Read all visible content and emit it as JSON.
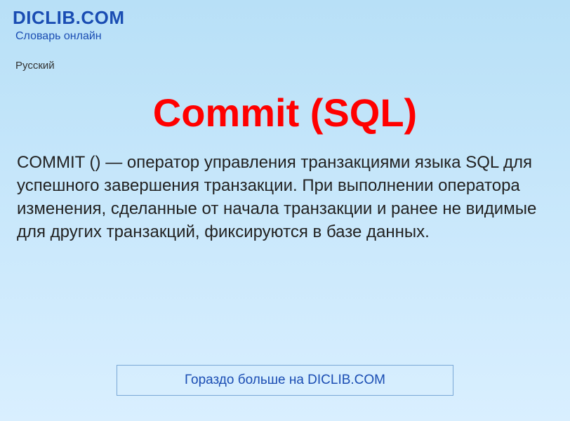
{
  "header": {
    "site_name": "DICLIB.COM",
    "tagline": "Словарь онлайн",
    "language": "Русский"
  },
  "main": {
    "title": "Commit (SQL)",
    "body": "COMMIT () — оператор управления транзакциями языка SQL для успешного завершения транзакции. При выполнении оператора изменения, сделанные от начала транзакции и ранее не видимые для других транзакций, фиксируются в базе данных."
  },
  "footer": {
    "cta": "Гораздо больше на DICLIB.COM"
  }
}
